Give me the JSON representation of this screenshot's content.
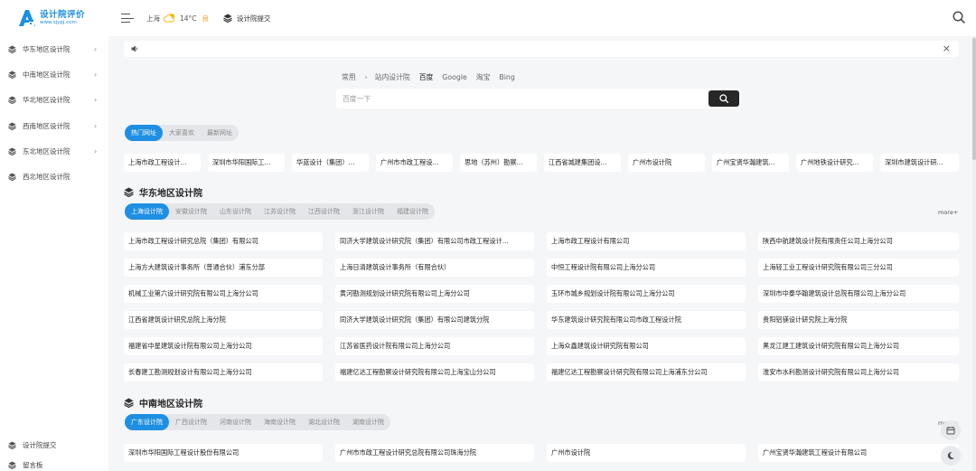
{
  "header": {
    "logo_title": "设计院评价",
    "logo_url": "www.sjypj.com",
    "city": "上海",
    "temperature": "14°C",
    "air_quality": "良",
    "submit_label": "设计院提交"
  },
  "sidebar": {
    "items": [
      {
        "label": "华东地区设计院"
      },
      {
        "label": "中南地区设计院"
      },
      {
        "label": "华北地区设计院"
      },
      {
        "label": "西南地区设计院"
      },
      {
        "label": "东北地区设计院"
      },
      {
        "label": "西北地区设计院"
      }
    ],
    "bottom": [
      {
        "label": "设计院提交"
      },
      {
        "label": "留言板"
      }
    ]
  },
  "search": {
    "engines": [
      "常用",
      "站内设计院",
      "百度",
      "Google",
      "淘宝",
      "Bing"
    ],
    "placeholder": "百度一下"
  },
  "hot": {
    "tabs": [
      "热门网址",
      "大家喜欢",
      "最新网址"
    ],
    "links": [
      "上海市政工程设计...",
      "深圳市华阳国际工...",
      "华蓝设计（集团）...",
      "广州市市政工程设...",
      "思地（苏州）勘察...",
      "江西省城建集团设...",
      "广州市设计院",
      "广州宝贤华瀚建筑...",
      "广州地铁设计研究...",
      "深圳市建筑设计研..."
    ]
  },
  "east": {
    "title": "华东地区设计院",
    "more": "more+",
    "tabs": [
      "上海设计院",
      "安徽设计院",
      "山东设计院",
      "江苏设计院",
      "江西设计院",
      "浙江设计院",
      "福建设计院"
    ],
    "rows": [
      [
        "上海市政工程设计研究总院（集团）有限公司",
        "同济大学建筑设计研究院（集团）有限公司市政工程设计...",
        "上海市政工程设计有限公司",
        "陕西中航建筑设计院有限责任公司上海分公司"
      ],
      [
        "上海方大建筑设计事务所（普通合伙）浦东分部",
        "上海日清建筑设计事务所（有限合伙）",
        "中恒工程设计院有限公司上海分公司",
        "上海轻工业工程设计研究院有限公司三分公司"
      ],
      [
        "机械工业第六设计研究院有限公司上海分公司",
        "黄河勘测规划设计研究院有限公司上海分公司",
        "玉环市城乡规划设计院有限公司上海分公司",
        "深圳市中泰华翰建筑设计总院有限公司上海分公司"
      ],
      [
        "江西省建筑设计研究总院上海分院",
        "同济大学建筑设计研究院（集团）有限公司建筑分院",
        "华东建筑设计研究院有限公司市政工程设计院",
        "贵阳铝镁设计研究院上海分院"
      ],
      [
        "福建省中星建筑设计院有限公司上海分公司",
        "江苏省医药设计院有限公司上海分公司",
        "上海众鑫建筑设计研究院有限公司",
        "黑龙江建工建筑设计研究院有限公司上海分公司"
      ],
      [
        "长春建工勘测规划设计有限公司上海分公司",
        "福建亿达工程勘察设计研究院有限公司上海宝山分公司",
        "福建亿达工程勘察设计研究院有限公司上海浦东分公司",
        "淮安市水利勘测设计研究院有限公司上海分公司"
      ]
    ]
  },
  "central": {
    "title": "中南地区设计院",
    "more": "more+",
    "tabs": [
      "广东设计院",
      "广西设计院",
      "河南设计院",
      "海南设计院",
      "湖北设计院",
      "湖南设计院"
    ],
    "rows": [
      [
        "深圳市华阳国际工程设计股份有限公司",
        "广州市市政工程设计研究总院有限公司珠海分院",
        "广州市设计院",
        "广州宝贤华瀚建筑工程设计有限公司"
      ]
    ]
  }
}
